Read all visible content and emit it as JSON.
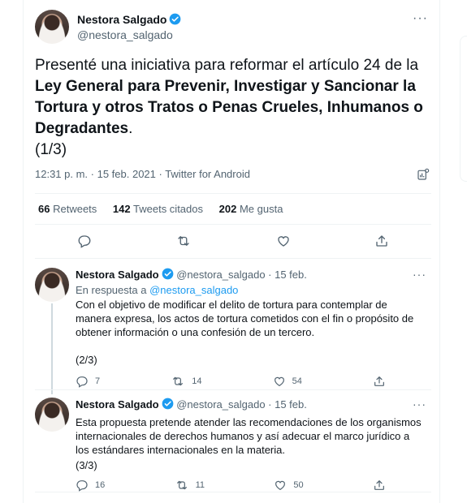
{
  "main_tweet": {
    "author_name": "Nestora Salgado",
    "handle": "@nestora_salgado",
    "text_intro": "Presenté una iniciativa para reformar el artículo 24 de la",
    "text_bold": "Ley General para Prevenir, Investigar y Sancionar la Tortura y otros Tratos o Penas Crueles, Inhumanos o Degradantes",
    "text_end": ".",
    "thread_marker": "(1/3)",
    "meta": "12:31 p. m. · 15 feb. 2021 · Twitter for Android",
    "stats": {
      "retweets_count": "66",
      "retweets_label": "Retweets",
      "quotes_count": "142",
      "quotes_label": "Tweets citados",
      "likes_count": "202",
      "likes_label": "Me gusta"
    }
  },
  "replies": [
    {
      "author_name": "Nestora Salgado",
      "handle": "@nestora_salgado",
      "date": "· 15 feb.",
      "reply_to_label": "En respuesta a",
      "reply_to_handle": "@nestora_salgado",
      "text": "Con el objetivo de modificar el delito de tortura para contemplar de manera expresa, los actos de tortura cometidos con el fin o propósito de obtener información o una confesión de un tercero.",
      "thread_marker": "(2/3)",
      "replies_count": "7",
      "retweets_count": "14",
      "likes_count": "54"
    },
    {
      "author_name": "Nestora Salgado",
      "handle": "@nestora_salgado",
      "date": "· 15 feb.",
      "text": "Esta propuesta pretende atender las recomendaciones de los organismos internacionales de derechos humanos y así adecuar el marco jurídico a los estándares internacionales en la materia.",
      "thread_marker": "(3/3)",
      "replies_count": "16",
      "retweets_count": "11",
      "likes_count": "50"
    }
  ],
  "more_glyph": "···",
  "colors": {
    "accent": "#1d9bf0",
    "muted": "#536471",
    "text": "#0f1419",
    "border": "#eff3f4"
  }
}
